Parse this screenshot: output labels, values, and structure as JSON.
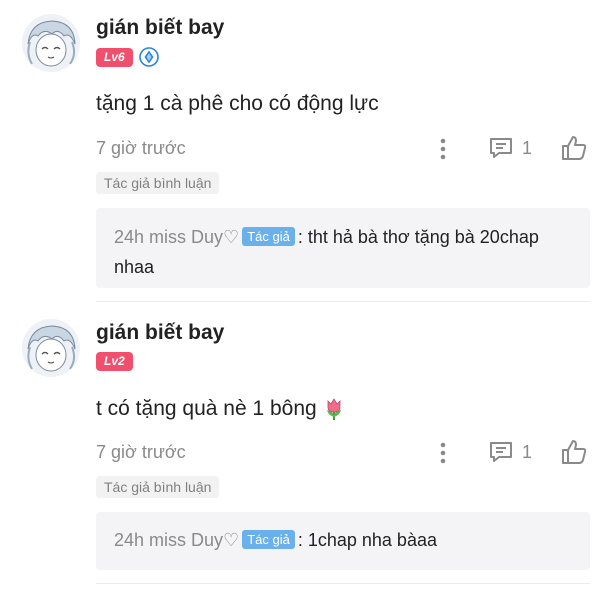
{
  "comments": [
    {
      "username": "gián biết bay",
      "level": "Lv6",
      "has_rank_icon": true,
      "text": "tặng 1 cà phê cho có động lực",
      "emoji": "",
      "timestamp": "7 giờ trước",
      "reply_count": "1",
      "author_tag": "Tác giả bình luận",
      "reply": {
        "author": "24h miss Duy♡",
        "badge": "Tác giả",
        "separator": ":",
        "text": "tht hả bà thơ tặng bà 20chap nhaa"
      }
    },
    {
      "username": "gián biết bay",
      "level": "Lv2",
      "has_rank_icon": false,
      "text": "t có tặng quà nè 1 bông",
      "emoji": "tulip-icon",
      "timestamp": "7 giờ trước",
      "reply_count": "1",
      "author_tag": "Tác giả bình luận",
      "reply": {
        "author": "24h miss Duy♡",
        "badge": "Tác giả",
        "separator": ":",
        "text": "1chap nha bàaa"
      }
    }
  ],
  "colors": {
    "level_badge": "#f0506e",
    "author_chip": "#6ab0ea",
    "muted_text": "#8a8a8a",
    "reply_bg": "#f4f4f6"
  }
}
